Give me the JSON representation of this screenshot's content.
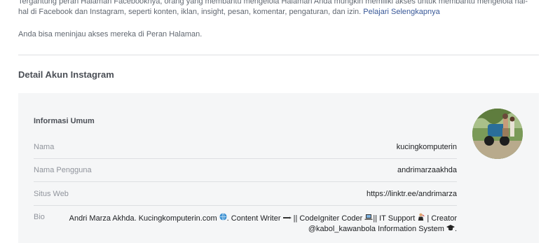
{
  "intro": {
    "text": "Tergantung peran Halaman Facebooknya, orang yang membantu mengelola Halaman Anda mungkin memiliki akses untuk membantu mengelola hal-hal di Facebook dan Instagram, seperti konten, iklan, insight, pesan, komentar, pengaturan, dan izin.",
    "link": "Pelajari Selengkapnya",
    "review_text": "Anda bisa meninjau akses mereka di Peran Halaman."
  },
  "section": {
    "title": "Detail Akun Instagram"
  },
  "card": {
    "heading": "Informasi Umum",
    "rows": [
      {
        "label": "Nama",
        "value": "kucingkomputerin"
      },
      {
        "label": "Nama Pengguna",
        "value": "andrimarzaakhda"
      },
      {
        "label": "Situs Web",
        "value": "https://linktr.ee/andrimarza"
      }
    ],
    "bio": {
      "label": "Bio",
      "part1": "Andri Marza Akhda. Kucingkomputerin.com",
      "part2": ". Content Writer",
      "part3": " || CodeIgniter Coder",
      "part4": "|| IT Support",
      "part5": " | Creator",
      "part6": "@kabol_kawanbola Information System",
      "part7": "."
    }
  },
  "icons": {
    "globe": "globe-icon",
    "pen": "pen-icon",
    "laptop": "laptop-icon",
    "technician": "technician-icon",
    "graduation": "graduation-cap-icon"
  },
  "colors": {
    "link": "#385898",
    "card_bg": "#f5f6f7",
    "muted_text": "#606770"
  }
}
